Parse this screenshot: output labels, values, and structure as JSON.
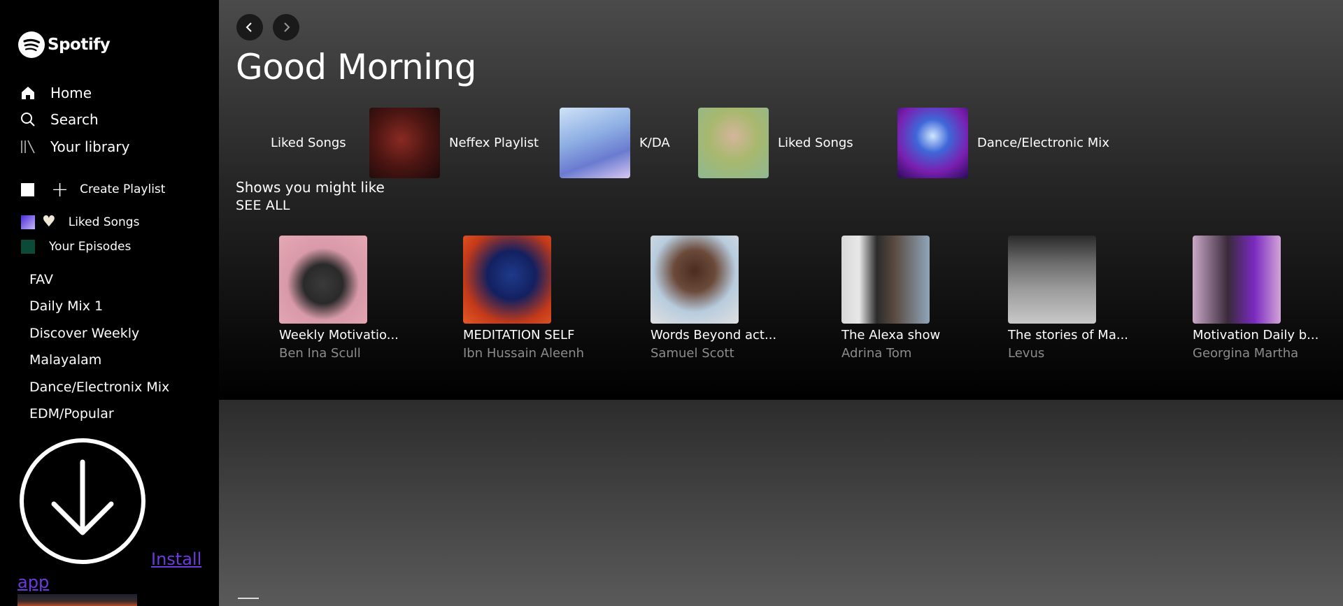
{
  "app": {
    "name": "Spotify"
  },
  "sidebar": {
    "nav": [
      {
        "label": "Home",
        "icon": "home-icon"
      },
      {
        "label": "Search",
        "icon": "search-icon"
      },
      {
        "label": "Your library",
        "icon": "library-icon"
      }
    ],
    "create_playlist": "Create Playlist",
    "liked_songs": "Liked Songs",
    "your_episodes": "Your Episodes",
    "playlists": [
      "FAV",
      "Daily Mix 1",
      "Discover Weekly",
      "Malayalam",
      "Dance/Electronix Mix",
      "EDM/Popular"
    ],
    "install": {
      "part1": "Install",
      "part2": "app",
      "icon": "download-icon"
    }
  },
  "main": {
    "greeting": "Good Morning",
    "quick_picks": [
      {
        "label": "Liked Songs",
        "has_art": false
      },
      {
        "label": "Neffex Playlist",
        "has_art": true
      },
      {
        "label": "K/DA",
        "has_art": true
      },
      {
        "label": "Liked Songs",
        "has_art": true
      },
      {
        "label": "Dance/Electronic Mix",
        "has_art": true
      }
    ],
    "shows_title": "Shows you might like",
    "see_all": "SEE ALL",
    "shows": [
      {
        "title": "Weekly Motivatio...",
        "author": "Ben Ina Scull"
      },
      {
        "title": "MEDITATION SELF",
        "author": "Ibn Hussain Aleenh"
      },
      {
        "title": "Words Beyond act...",
        "author": "Samuel Scott"
      },
      {
        "title": "The Alexa show",
        "author": "Adrina Tom"
      },
      {
        "title": "The stories of Ma...",
        "author": "Levus"
      },
      {
        "title": "Motivation Daily b...",
        "author": "Georgina Martha"
      }
    ]
  },
  "colors": {
    "accent": "#1db954",
    "link": "#6d3ae0"
  }
}
